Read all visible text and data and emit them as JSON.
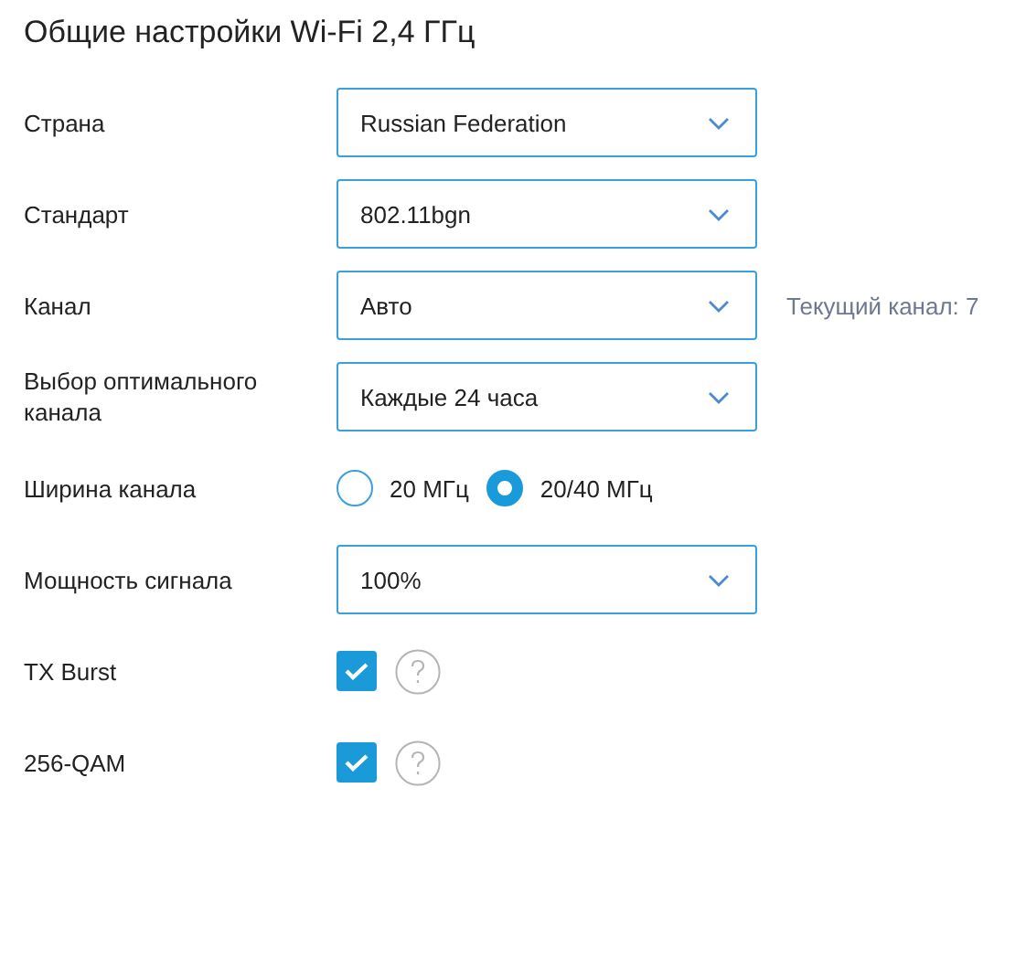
{
  "title": "Общие настройки Wi-Fi 2,4 ГГц",
  "rows": [
    {
      "kind": "select",
      "label": "Страна",
      "value": "Russian Federation"
    },
    {
      "kind": "select",
      "label": "Стандарт",
      "value": "802.11bgn"
    },
    {
      "kind": "select",
      "label": "Канал",
      "value": "Авто",
      "note": "Текущий канал: 7"
    },
    {
      "kind": "select",
      "label": "Выбор оптимального канала",
      "value": "Каждые 24 часа"
    },
    {
      "kind": "radio",
      "label": "Ширина канала",
      "options": [
        {
          "label": "20 МГц",
          "selected": false
        },
        {
          "label": "20/40 МГц",
          "selected": true
        }
      ]
    },
    {
      "kind": "select",
      "label": "Мощность сигнала",
      "value": "100%"
    },
    {
      "kind": "checkbox",
      "label": "TX Burst",
      "checked": true,
      "help": true
    },
    {
      "kind": "checkbox",
      "label": "256-QAM",
      "checked": true,
      "help": true
    }
  ]
}
